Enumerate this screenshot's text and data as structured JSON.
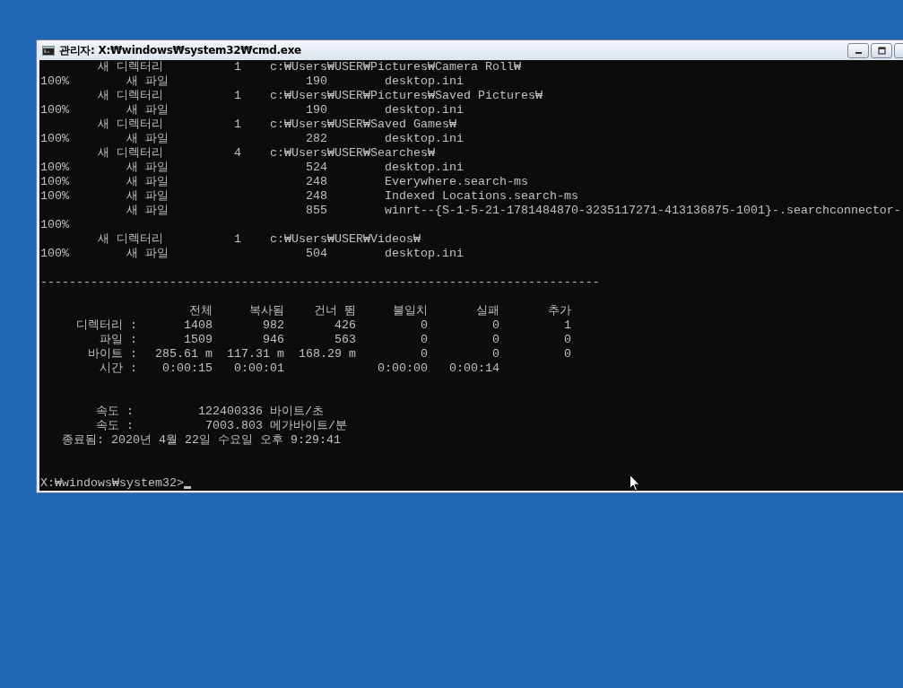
{
  "window": {
    "title": "관리자: X:₩windows₩system32₩cmd.exe"
  },
  "listing": [
    {
      "kind": "dir",
      "label": "새 디렉터리",
      "count": "1",
      "path": "c:₩Users₩USER₩Pictures₩Camera Roll₩"
    },
    {
      "kind": "file",
      "percent": "100%",
      "label": "새 파일",
      "size": "190",
      "name": "desktop.ini"
    },
    {
      "kind": "dir",
      "label": "새 디렉터리",
      "count": "1",
      "path": "c:₩Users₩USER₩Pictures₩Saved Pictures₩"
    },
    {
      "kind": "file",
      "percent": "100%",
      "label": "새 파일",
      "size": "190",
      "name": "desktop.ini"
    },
    {
      "kind": "dir",
      "label": "새 디렉터리",
      "count": "1",
      "path": "c:₩Users₩USER₩Saved Games₩"
    },
    {
      "kind": "file",
      "percent": "100%",
      "label": "새 파일",
      "size": "282",
      "name": "desktop.ini"
    },
    {
      "kind": "dir",
      "label": "새 디렉터리",
      "count": "4",
      "path": "c:₩Users₩USER₩Searches₩"
    },
    {
      "kind": "file",
      "percent": "100%",
      "label": "새 파일",
      "size": "524",
      "name": "desktop.ini"
    },
    {
      "kind": "file",
      "percent": "100%",
      "label": "새 파일",
      "size": "248",
      "name": "Everywhere.search-ms"
    },
    {
      "kind": "file",
      "percent": "100%",
      "label": "새 파일",
      "size": "248",
      "name": "Indexed Locations.search-ms"
    },
    {
      "kind": "file",
      "label": "새 파일",
      "size": "855",
      "name": "winrt--{S-1-5-21-1781484870-3235117271-413136875-1001}-.searchconnector-"
    },
    {
      "kind": "percent",
      "percent": "100%"
    },
    {
      "kind": "dir",
      "label": "새 디렉터리",
      "count": "1",
      "path": "c:₩Users₩USER₩Videos₩"
    },
    {
      "kind": "file",
      "percent": "100%",
      "label": "새 파일",
      "size": "504",
      "name": "desktop.ini"
    }
  ],
  "separator": "------------------------------------------------------------------------------",
  "summary": {
    "columns": [
      "전체",
      "복사됨",
      "건너 뜀",
      "불일치",
      "실패",
      "추가"
    ],
    "rows": [
      {
        "label": "디렉터리 :",
        "values": [
          {
            "kind": "value",
            "text": "1408"
          },
          {
            "kind": "value",
            "text": "982"
          },
          {
            "kind": "value",
            "text": "426"
          },
          {
            "kind": "value",
            "text": "0"
          },
          {
            "kind": "value",
            "text": "0"
          },
          {
            "kind": "value",
            "text": "1"
          }
        ]
      },
      {
        "label": "파일 :",
        "values": [
          {
            "kind": "value",
            "text": "1509"
          },
          {
            "kind": "value",
            "text": "946"
          },
          {
            "kind": "value",
            "text": "563"
          },
          {
            "kind": "value",
            "text": "0"
          },
          {
            "kind": "value",
            "text": "0"
          },
          {
            "kind": "value",
            "text": "0"
          }
        ]
      },
      {
        "label": "바이트 :",
        "values": [
          {
            "kind": "value",
            "text": "285.61 m"
          },
          {
            "kind": "value",
            "text": "117.31 m"
          },
          {
            "kind": "value",
            "text": "168.29 m"
          },
          {
            "kind": "value",
            "text": "0"
          },
          {
            "kind": "value",
            "text": "0"
          },
          {
            "kind": "value",
            "text": "0"
          }
        ]
      },
      {
        "label": "시간 :",
        "values": [
          {
            "kind": "value",
            "text": "0:00:15"
          },
          {
            "kind": "value",
            "text": "0:00:01"
          },
          {
            "kind": "blank"
          },
          {
            "kind": "value",
            "text": "0:00:00"
          },
          {
            "kind": "value",
            "text": "0:00:14"
          },
          {
            "kind": "blank"
          }
        ]
      }
    ]
  },
  "speeds": [
    {
      "label": "속도 :",
      "number": "122400336",
      "unit": "바이트/초"
    },
    {
      "label": "속도 :",
      "number": "7003.803",
      "unit": "메가바이트/분"
    }
  ],
  "finished": {
    "label": "종료됨:",
    "value": "2020년 4월 22일 수요일 오후 9:29:41"
  },
  "prompt": "X:₩windows₩system32>"
}
